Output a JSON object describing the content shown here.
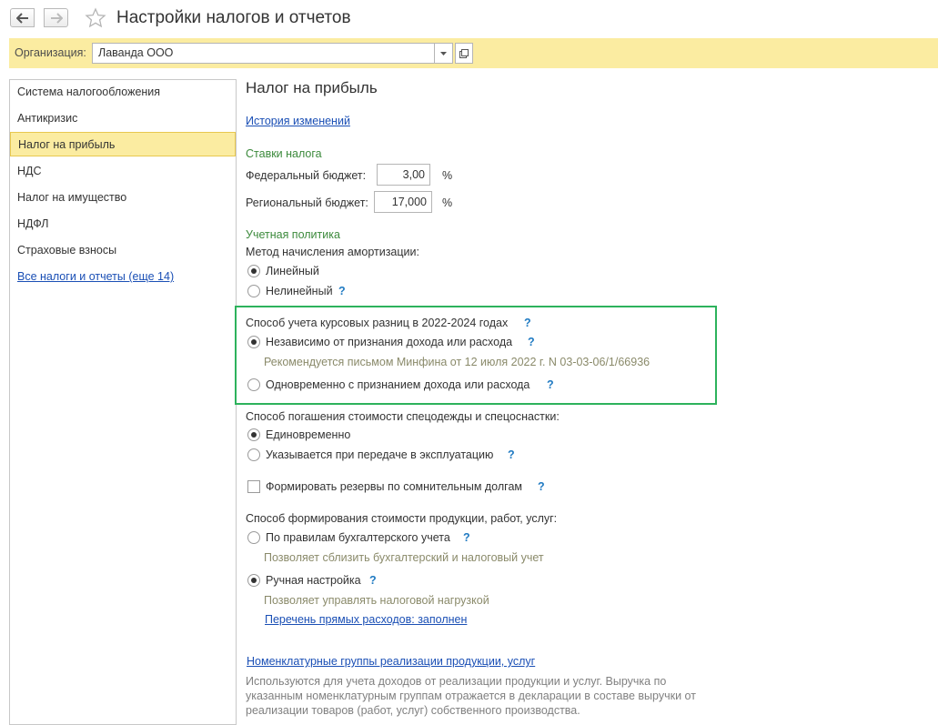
{
  "window": {
    "title": "Настройки налогов и отчетов"
  },
  "org": {
    "label": "Организация:",
    "value": "Лаванда ООО"
  },
  "sidebar": {
    "items": [
      {
        "label": "Система налогообложения"
      },
      {
        "label": "Антикризис"
      },
      {
        "label": "Налог на прибыль",
        "active": true
      },
      {
        "label": "НДС"
      },
      {
        "label": "Налог на имущество"
      },
      {
        "label": "НДФЛ"
      },
      {
        "label": "Страховые взносы"
      }
    ],
    "all_link": "Все налоги и отчеты (еще 14)"
  },
  "main": {
    "title": "Налог на прибыль",
    "history_link": "История изменений",
    "rates": {
      "title": "Ставки налога",
      "federal_label": "Федеральный бюджет:",
      "federal_value": "3,00",
      "regional_label": "Региональный бюджет:",
      "regional_value": "17,000",
      "unit": "%"
    },
    "policy": {
      "title": "Учетная политика",
      "amort_label": "Метод начисления амортизации:",
      "amort_linear": "Линейный",
      "amort_nonlinear": "Нелинейный"
    },
    "fx": {
      "label": "Способ учета курсовых разниц в 2022-2024 годах",
      "opt1": "Независимо от признания дохода или расхода",
      "opt1_hint": "Рекомендуется письмом Минфина от 12 июля 2022 г. N 03-03-06/1/66936",
      "opt2": "Одновременно с признанием дохода или расхода"
    },
    "workwear": {
      "label": "Способ погашения стоимости спецодежды и спецоснастки:",
      "opt1": "Единовременно",
      "opt2": "Указывается при передаче в эксплуатацию"
    },
    "reserves": {
      "label": "Формировать резервы по сомнительным долгам"
    },
    "cost": {
      "label": "Способ формирования стоимости продукции, работ, услуг:",
      "opt1": "По правилам бухгалтерского учета",
      "opt1_hint": "Позволяет сблизить бухгалтерский и налоговый учет",
      "opt2": "Ручная настройка",
      "opt2_hint": "Позволяет управлять налоговой нагрузкой",
      "direct_link": "Перечень прямых расходов: заполнен"
    },
    "nomen": {
      "link": "Номенклатурные группы реализации продукции, услуг",
      "desc": "Используются для учета доходов от реализации продукции и услуг. Выручка по указанным номенклатурным группам отражается в декларации в составе выручки от реализации товаров (работ, услуг) собственного производства."
    },
    "help_mark": "?"
  },
  "colors": {
    "accent_yellow": "#fbeca1",
    "link_blue": "#1a4fb5",
    "group_green": "#3c8a3c",
    "highlight_green": "#2db25c"
  }
}
